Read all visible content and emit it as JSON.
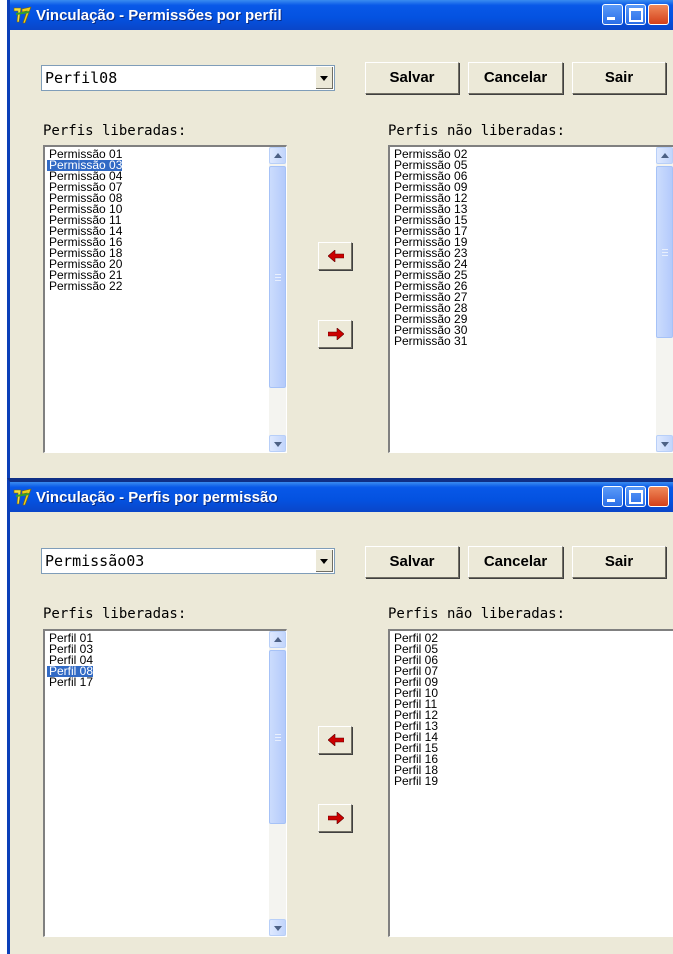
{
  "windows": [
    {
      "title": "Vinculação - Permissões por perfil",
      "combo_value": "Perfil08",
      "buttons": {
        "save": "Salvar",
        "cancel": "Cancelar",
        "exit": "Sair"
      },
      "left_label": "Perfis liberadas:",
      "right_label": "Perfis não liberadas:",
      "left_list": [
        "Permissão 01",
        "Permissão 03",
        "Permissão 04",
        "Permissão 07",
        "Permissão 08",
        "Permissão 10",
        "Permissão 11",
        "Permissão 14",
        "Permissão 16",
        "Permissão 18",
        "Permissão 20",
        "Permissão 21",
        "Permissão 22"
      ],
      "left_selected": "Permissão 03",
      "right_list": [
        "Permissão 02",
        "Permissão 05",
        "Permissão 06",
        "Permissão 09",
        "Permissão 12",
        "Permissão 13",
        "Permissão 15",
        "Permissão 17",
        "Permissão 19",
        "Permissão 23",
        "Permissão 24",
        "Permissão 25",
        "Permissão 26",
        "Permissão 27",
        "Permissão 28",
        "Permissão 29",
        "Permissão 30",
        "Permissão 31"
      ]
    },
    {
      "title": "Vinculação - Perfis por permissão",
      "combo_value": "Permissão03",
      "buttons": {
        "save": "Salvar",
        "cancel": "Cancelar",
        "exit": "Sair"
      },
      "left_label": "Perfis liberadas:",
      "right_label": "Perfis não liberadas:",
      "left_list": [
        "Perfil 01",
        "Perfil 03",
        "Perfil 04",
        "Perfil 08",
        "Perfil 17"
      ],
      "left_selected": "Perfil 08",
      "right_list": [
        "Perfil 02",
        "Perfil 05",
        "Perfil 06",
        "Perfil 07",
        "Perfil 09",
        "Perfil 10",
        "Perfil 11",
        "Perfil 12",
        "Perfil 13",
        "Perfil 14",
        "Perfil 15",
        "Perfil 16",
        "Perfil 18",
        "Perfil 19"
      ]
    }
  ],
  "icons": {
    "app": "app-logo-icon",
    "move_left": "arrow-left-icon",
    "move_right": "arrow-right-icon",
    "minimize": "minimize-icon",
    "maximize": "maximize-icon",
    "close": "close-icon"
  },
  "colors": {
    "titlebar": "#0452e0",
    "window_bg": "#ece9d8",
    "selection": "#316ac5",
    "arrow_red": "#cc0000"
  }
}
